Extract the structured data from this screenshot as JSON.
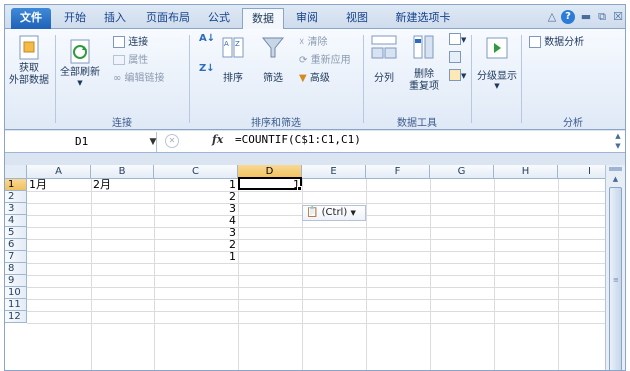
{
  "tabs": [
    {
      "label": "文件"
    },
    {
      "label": "开始"
    },
    {
      "label": "插入"
    },
    {
      "label": "页面布局"
    },
    {
      "label": "公式"
    },
    {
      "label": "数据"
    },
    {
      "label": "审阅"
    },
    {
      "label": "视图"
    },
    {
      "label": "新建选项卡"
    }
  ],
  "active_tab": "数据",
  "ribbon": {
    "external": {
      "label": "获取\n外部数据"
    },
    "refresh": {
      "label": "全部刷新"
    },
    "connections": {
      "connect": "连接",
      "properties": "属性",
      "edit_links": "编辑链接",
      "group_label": "连接"
    },
    "sort": {
      "sort": "排序",
      "filter": "筛选",
      "clear": "清除",
      "reapply": "重新应用",
      "advanced": "高级",
      "group_label": "排序和筛选"
    },
    "tools": {
      "text_to_columns": "分列",
      "remove_dup_1": "删除",
      "remove_dup_2": "重复项",
      "group_label": "数据工具"
    },
    "outline": {
      "label": "分级显示"
    },
    "analysis": {
      "data_analysis": "数据分析",
      "group_label": "分析"
    }
  },
  "formula_bar": {
    "name_box": "D1",
    "fx": "fx",
    "formula": "=COUNTIF(C$1:C1,C1)"
  },
  "columns": [
    "A",
    "B",
    "C",
    "D",
    "E",
    "F",
    "G",
    "H",
    "I"
  ],
  "selected_column": "D",
  "rows": [
    "1",
    "2",
    "3",
    "4",
    "5",
    "6",
    "7",
    "8",
    "9",
    "10",
    "11",
    "12"
  ],
  "selected_row": "1",
  "cells": {
    "A1": "1月",
    "B1": "2月",
    "C": [
      "1",
      "2",
      "3",
      "4",
      "3",
      "2",
      "1"
    ],
    "D1": "1"
  },
  "paste_options": "(Ctrl)"
}
